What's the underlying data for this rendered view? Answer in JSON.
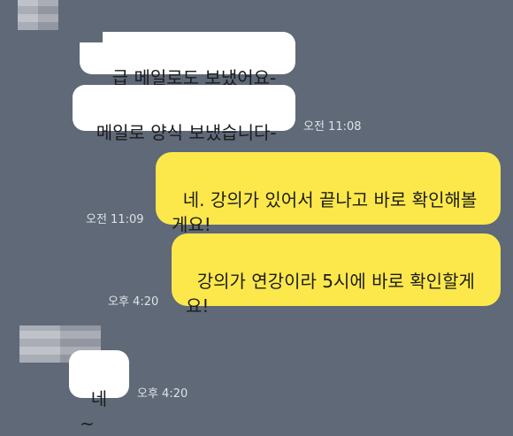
{
  "chat": {
    "messages": [
      {
        "side": "in",
        "text": "급 메일로도 보냈어요-",
        "time": ""
      },
      {
        "side": "in",
        "text": "메일로 양식 보냈습니다-",
        "time": "오전 11:08"
      },
      {
        "side": "out",
        "text": "네. 강의가 있어서 끝나고 바로 확인해볼게요!",
        "time": "오전 11:09"
      },
      {
        "side": "out",
        "text": "강의가 연강이라 5시에 바로 확인할게요!",
        "time": "오후 4:20"
      },
      {
        "side": "in",
        "text": "네~",
        "time": "오후 4:20"
      }
    ]
  },
  "colors": {
    "background": "#5f6978",
    "incoming_bubble": "#ffffff",
    "outgoing_bubble": "#fde84c",
    "timestamp": "#dfe2e6"
  }
}
